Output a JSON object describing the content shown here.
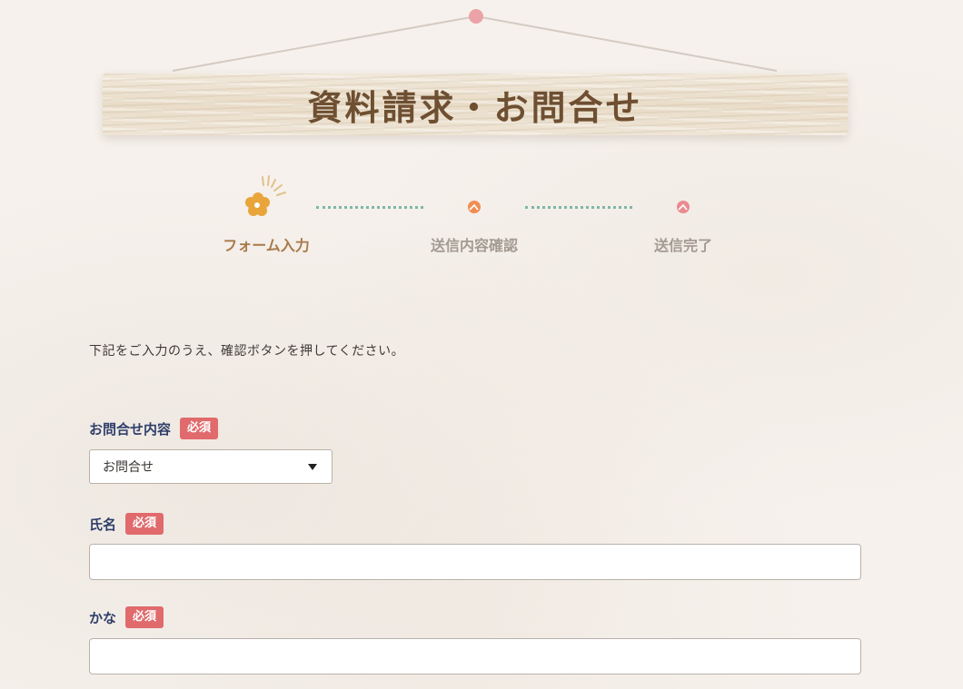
{
  "header": {
    "title": "資料請求・お問合せ"
  },
  "steps": [
    {
      "label": "フォーム入力",
      "state": "active",
      "icon": "flower-icon"
    },
    {
      "label": "送信内容確認",
      "state": "inactive",
      "icon": "ball-orange-icon"
    },
    {
      "label": "送信完了",
      "state": "inactive",
      "icon": "ball-pink-icon"
    }
  ],
  "colors": {
    "accent_active": "#e9a43a",
    "step2_ball": "#ef8e52",
    "step3_ball": "#ea8a90",
    "dots": "#7fb7a7",
    "badge": "#e06a6c",
    "label": "#2f3f6a"
  },
  "form": {
    "instruction": "下記をご入力のうえ、確認ボタンを押してください。",
    "inquiry_type": {
      "label": "お問合せ内容",
      "required_badge": "必須",
      "selected": "お問合せ"
    },
    "name": {
      "label": "氏名",
      "required_badge": "必須",
      "value": ""
    },
    "kana": {
      "label": "かな",
      "required_badge": "必須",
      "value": ""
    }
  }
}
